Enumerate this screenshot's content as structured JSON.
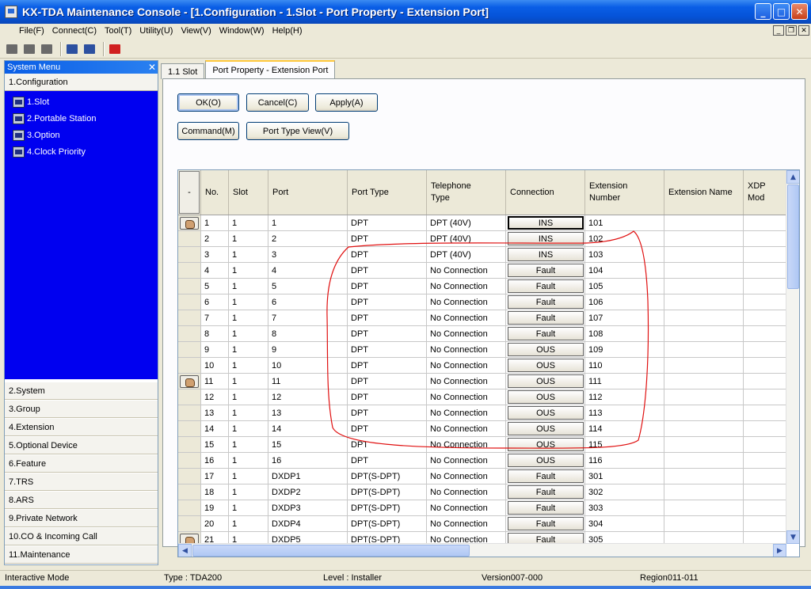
{
  "window": {
    "title": "KX-TDA Maintenance Console - [1.Configuration - 1.Slot - Port Property - Extension Port]"
  },
  "menubar": {
    "items": [
      "File(F)",
      "Connect(C)",
      "Tool(T)",
      "Utility(U)",
      "View(V)",
      "Window(W)",
      "Help(H)"
    ]
  },
  "system_menu": {
    "title": "System Menu",
    "close_glyph": "✕",
    "section": "1.Configuration",
    "tree": [
      "1.Slot",
      "2.Portable Station",
      "3.Option",
      "4.Clock Priority"
    ],
    "categories": [
      "2.System",
      "3.Group",
      "4.Extension",
      "5.Optional Device",
      "6.Feature",
      "7.TRS",
      "8.ARS",
      "9.Private Network",
      "10.CO & Incoming Call",
      "11.Maintenance"
    ]
  },
  "tabs": [
    "1.1 Slot",
    "Port Property - Extension Port"
  ],
  "buttons": {
    "ok": "OK(O)",
    "cancel": "Cancel(C)",
    "apply": "Apply(A)",
    "command": "Command(M)",
    "port_type_view": "Port Type View(V)"
  },
  "grid": {
    "corner": "-",
    "headers": {
      "no": "No.",
      "slot": "Slot",
      "port": "Port",
      "port_type": "Port Type",
      "telephone_type": "Telephone\nType",
      "connection": "Connection",
      "extension_number": "Extension\nNumber",
      "extension_name": "Extension Name",
      "xdp_mode": "XDP Mod"
    },
    "rows": [
      {
        "no": "1",
        "slot": "1",
        "port": "1",
        "ptype": "DPT",
        "tel": "DPT (40V)",
        "conn": "INS",
        "ext": "101"
      },
      {
        "no": "2",
        "slot": "1",
        "port": "2",
        "ptype": "DPT",
        "tel": "DPT (40V)",
        "conn": "INS",
        "ext": "102"
      },
      {
        "no": "3",
        "slot": "1",
        "port": "3",
        "ptype": "DPT",
        "tel": "DPT (40V)",
        "conn": "INS",
        "ext": "103"
      },
      {
        "no": "4",
        "slot": "1",
        "port": "4",
        "ptype": "DPT",
        "tel": "No Connection",
        "conn": "Fault",
        "ext": "104"
      },
      {
        "no": "5",
        "slot": "1",
        "port": "5",
        "ptype": "DPT",
        "tel": "No Connection",
        "conn": "Fault",
        "ext": "105"
      },
      {
        "no": "6",
        "slot": "1",
        "port": "6",
        "ptype": "DPT",
        "tel": "No Connection",
        "conn": "Fault",
        "ext": "106"
      },
      {
        "no": "7",
        "slot": "1",
        "port": "7",
        "ptype": "DPT",
        "tel": "No Connection",
        "conn": "Fault",
        "ext": "107"
      },
      {
        "no": "8",
        "slot": "1",
        "port": "8",
        "ptype": "DPT",
        "tel": "No Connection",
        "conn": "Fault",
        "ext": "108"
      },
      {
        "no": "9",
        "slot": "1",
        "port": "9",
        "ptype": "DPT",
        "tel": "No Connection",
        "conn": "OUS",
        "ext": "109"
      },
      {
        "no": "10",
        "slot": "1",
        "port": "10",
        "ptype": "DPT",
        "tel": "No Connection",
        "conn": "OUS",
        "ext": "110"
      },
      {
        "no": "11",
        "slot": "1",
        "port": "11",
        "ptype": "DPT",
        "tel": "No Connection",
        "conn": "OUS",
        "ext": "111"
      },
      {
        "no": "12",
        "slot": "1",
        "port": "12",
        "ptype": "DPT",
        "tel": "No Connection",
        "conn": "OUS",
        "ext": "112"
      },
      {
        "no": "13",
        "slot": "1",
        "port": "13",
        "ptype": "DPT",
        "tel": "No Connection",
        "conn": "OUS",
        "ext": "113"
      },
      {
        "no": "14",
        "slot": "1",
        "port": "14",
        "ptype": "DPT",
        "tel": "No Connection",
        "conn": "OUS",
        "ext": "114"
      },
      {
        "no": "15",
        "slot": "1",
        "port": "15",
        "ptype": "DPT",
        "tel": "No Connection",
        "conn": "OUS",
        "ext": "115"
      },
      {
        "no": "16",
        "slot": "1",
        "port": "16",
        "ptype": "DPT",
        "tel": "No Connection",
        "conn": "OUS",
        "ext": "116"
      },
      {
        "no": "17",
        "slot": "1",
        "port": "DXDP1",
        "ptype": "DPT(S-DPT)",
        "tel": "No Connection",
        "conn": "Fault",
        "ext": "301"
      },
      {
        "no": "18",
        "slot": "1",
        "port": "DXDP2",
        "ptype": "DPT(S-DPT)",
        "tel": "No Connection",
        "conn": "Fault",
        "ext": "302"
      },
      {
        "no": "19",
        "slot": "1",
        "port": "DXDP3",
        "ptype": "DPT(S-DPT)",
        "tel": "No Connection",
        "conn": "Fault",
        "ext": "303"
      },
      {
        "no": "20",
        "slot": "1",
        "port": "DXDP4",
        "ptype": "DPT(S-DPT)",
        "tel": "No Connection",
        "conn": "Fault",
        "ext": "304"
      },
      {
        "no": "21",
        "slot": "1",
        "port": "DXDP5",
        "ptype": "DPT(S-DPT)",
        "tel": "No Connection",
        "conn": "Fault",
        "ext": "305"
      }
    ],
    "hand_icon_rows": [
      1,
      11,
      21
    ]
  },
  "status": {
    "mode": "Interactive Mode",
    "type": "Type : TDA200",
    "level": "Level : Installer",
    "version": "Version007-000",
    "region": "Region011-011"
  },
  "colors": {
    "tree_bg": "#0000f0",
    "annotation": "#e01010",
    "titlebar": "#0553d8"
  }
}
